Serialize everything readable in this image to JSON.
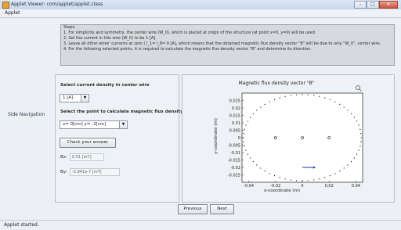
{
  "window": {
    "title": "Applet Viewer: com/applet/applet.class"
  },
  "menu": {
    "applet_label": "Applet"
  },
  "steps": {
    "heading": "Steps:",
    "lines": [
      "1. For simplicity and symmetry, the center wire (W_0), which is placed at origin of the structure (at point x=0, y=0) will be used.",
      "2. Set the current in this wire (W_0) to be 1 [A].",
      "3. Leave all other wires' currents at zero ( I_1= I_8= 0 [A], which means that the obtained magnetic flux density vector \"B\" will be due to only \"W_0\", center wire.",
      "4. For the following selected points, it is required to calculate the magnetic flux density vector \"B\" and determine its direction."
    ]
  },
  "side_navigation": {
    "label": "Side Navigation"
  },
  "controls": {
    "current_label": "Select current density in center wire",
    "current_value": "1 [A]",
    "point_label": "Select the point to calculate magnetic flux density at",
    "point_value": "x= 0[cm] y= -2[cm]",
    "check_button": "Check your answer",
    "bx_label": "Bx:",
    "bx_value": "0.01 [mT]",
    "by_label": "By:",
    "by_value": "-2.941e-7 [mT]"
  },
  "chart_data": {
    "type": "scatter",
    "title": "Magnetic flux density vector \"B\"",
    "xlabel": "x-coordinate (m)",
    "ylabel": "y-coordinate (m)",
    "xlim": [
      -0.045,
      0.045
    ],
    "ylim": [
      -0.03,
      0.03
    ],
    "xticks": [
      "-0.04",
      "-0.02",
      "0",
      "0.02",
      "0.04"
    ],
    "yticks": [
      "0.025",
      "0.02",
      "0.015",
      "0.01",
      "0.005",
      "0",
      "-0.005",
      "-0.01",
      "-0.015",
      "-0.02",
      "-0.025"
    ],
    "x_tick_values": [
      -0.04,
      -0.02,
      0,
      0.02,
      0.04
    ],
    "y_tick_values": [
      0.025,
      0.02,
      0.015,
      0.01,
      0.005,
      0,
      -0.005,
      -0.01,
      -0.015,
      -0.02,
      -0.025
    ],
    "wires": [
      {
        "x": -0.02,
        "y": 0
      },
      {
        "x": 0,
        "y": 0
      },
      {
        "x": 0.02,
        "y": 0
      }
    ],
    "boundary_points": {
      "count": 64,
      "center": [
        0,
        0
      ],
      "radius_x": 0.044,
      "radius_y": 0.029
    },
    "vector": {
      "x": 0,
      "y": -0.02,
      "dx": 0.01,
      "dy": 0
    },
    "colors": {
      "vector": "#1b2fb5",
      "wire": "#000000",
      "points": "#000000"
    }
  },
  "navigation": {
    "previous": "Previous",
    "next": "Next"
  },
  "status": {
    "text": "Applet started."
  }
}
